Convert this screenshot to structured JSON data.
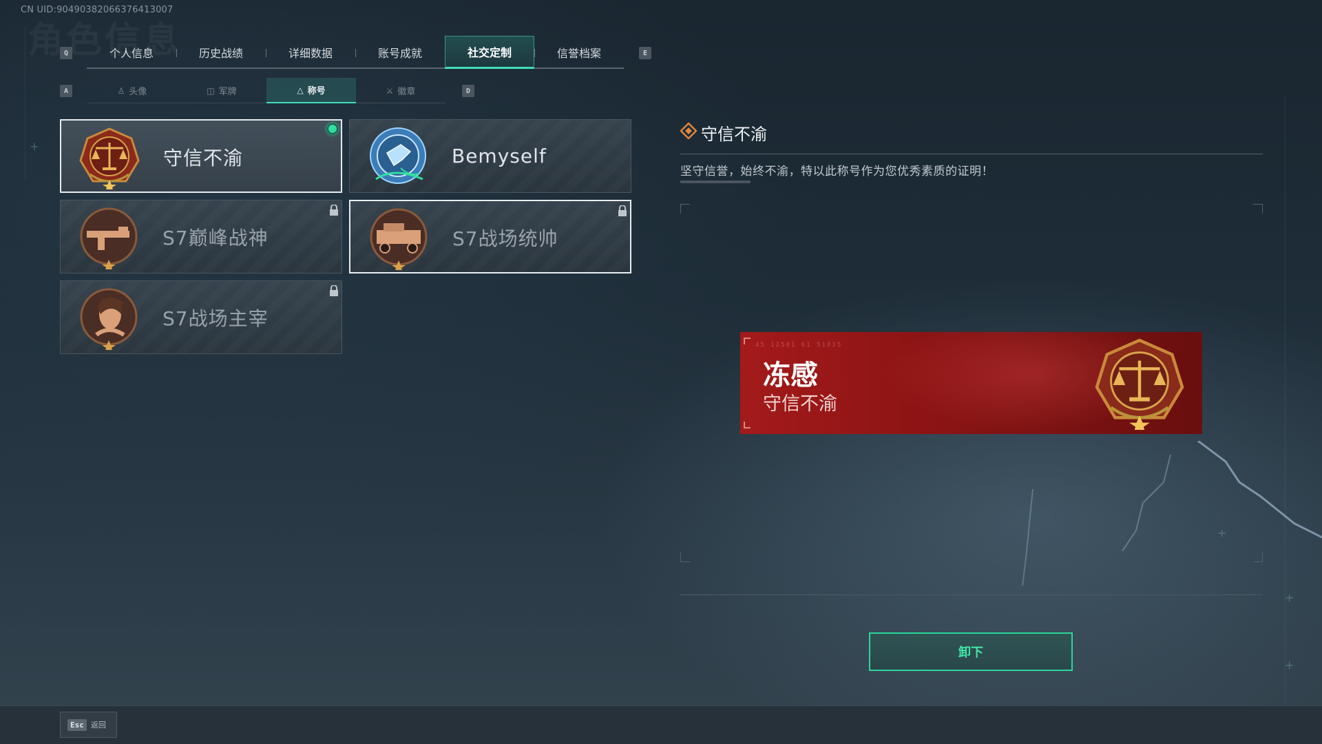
{
  "uid": "CN UID:9049038206637641300​7",
  "ghost_title": "角色信息",
  "top_tabs": {
    "left_key": "Q",
    "right_key": "E",
    "items": [
      {
        "label": "个人信息"
      },
      {
        "label": "历史战绩"
      },
      {
        "label": "详细数据"
      },
      {
        "label": "账号成就"
      },
      {
        "label": "社交定制"
      },
      {
        "label": "信誉档案"
      }
    ],
    "active_index": 4
  },
  "sub_tabs": {
    "left_key": "A",
    "right_key": "D",
    "items": [
      {
        "label": "头像",
        "icon": "person-icon"
      },
      {
        "label": "军牌",
        "icon": "dogtag-icon"
      },
      {
        "label": "称号",
        "icon": "triangle-icon"
      },
      {
        "label": "徽章",
        "icon": "emblem-icon"
      }
    ],
    "active_index": 2
  },
  "titles": [
    {
      "name": "守信不渝",
      "state": "equipped",
      "medal": "scales-medal-icon"
    },
    {
      "name": "Bemyself",
      "state": "owned",
      "medal": "bemyself-medal-icon"
    },
    {
      "name": "S7巅峰战神",
      "state": "locked",
      "medal": "gun-medal-icon"
    },
    {
      "name": "S7战场统帅",
      "state": "locked-selected",
      "medal": "vehicle-medal-icon"
    },
    {
      "name": "S7战场主宰",
      "state": "locked",
      "medal": "portrait-medal-icon"
    }
  ],
  "detail": {
    "title": "守信不渝",
    "description": "坚守信誉，始终不渝，特以此称号作为您优秀素质的证明！"
  },
  "banner": {
    "player_name": "冻感",
    "title": "守信不渝",
    "serial": "45 12501  61 51035"
  },
  "unequip_label": "卸下",
  "back": {
    "key": "Esc",
    "label": "返回"
  },
  "colors": {
    "accent": "#3fe0b8",
    "equipped_dot": "#2ee09e",
    "banner_red": "#a41a1a"
  }
}
